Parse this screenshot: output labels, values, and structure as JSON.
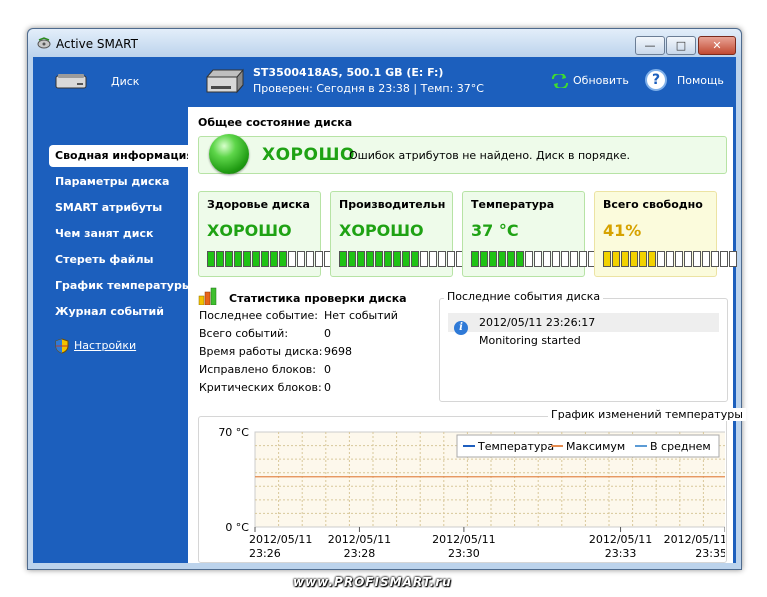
{
  "window": {
    "title": "Active SMART",
    "minimize_glyph": "—",
    "maximize_glyph": "□",
    "close_glyph": "✕"
  },
  "header": {
    "disk_label": "Диск",
    "model": "ST3500418AS, 500.1 GB (E: F:)",
    "status": "Проверен: Сегодня в 23:38 | Темп: 37°C",
    "refresh_label": "Обновить",
    "help_glyph": "?",
    "help_label": "Помощь"
  },
  "sidebar": {
    "items": [
      {
        "label": "Сводная информация",
        "active": true
      },
      {
        "label": "Параметры диска",
        "active": false
      },
      {
        "label": "SMART атрибуты",
        "active": false
      },
      {
        "label": "Чем занят диск",
        "active": false
      },
      {
        "label": "Стереть файлы",
        "active": false
      },
      {
        "label": "График температуры",
        "active": false
      },
      {
        "label": "Журнал событий",
        "active": false
      }
    ],
    "settings_label": "Настройки"
  },
  "overview": {
    "section_title": "Общее состояние диска",
    "status": "ХОРОШО",
    "message": "Ошибок атрибутов не найдено. Диск в порядке."
  },
  "cards": [
    {
      "title": "Здоровье диска",
      "value": "ХОРОШО",
      "level_fraction": 0.6,
      "color": "#1fc214"
    },
    {
      "title": "Производительн",
      "value": "ХОРОШО",
      "level_fraction": 0.6,
      "color": "#1fc214"
    },
    {
      "title": "Температура",
      "value": "37 °C",
      "level_fraction": 0.4,
      "color": "#1fc214"
    },
    {
      "title": "Всего свободно",
      "value": "41%",
      "level_fraction": 0.4,
      "color": "#f2d200"
    }
  ],
  "stats": {
    "title": "Статистика проверки диска",
    "rows": [
      {
        "label": "Последнее событие:",
        "value": "Нет событий"
      },
      {
        "label": "Всего событий:",
        "value": "0"
      },
      {
        "label": "Время работы диска:",
        "value": "9698"
      },
      {
        "label": "Исправлено блоков:",
        "value": "0"
      },
      {
        "label": "Критических блоков:",
        "value": "0"
      }
    ]
  },
  "events": {
    "title": "Последние события диска",
    "items": [
      {
        "time": "2012/05/11 23:26:17",
        "message": "Monitoring started"
      }
    ]
  },
  "chart_data": {
    "type": "line",
    "title": "График изменений температуры",
    "ylim": [
      0,
      70
    ],
    "ytick_labels": [
      "70 °C",
      "0 °C"
    ],
    "x_ticks": [
      {
        "date": "2012/05/11",
        "time": "23:26"
      },
      {
        "date": "2012/05/11",
        "time": "23:28"
      },
      {
        "date": "2012/05/11",
        "time": "23:30"
      },
      {
        "date": "2012/05/11",
        "time": "23:33"
      },
      {
        "date": "2012/05/11",
        "time": "23:35"
      }
    ],
    "legend": [
      "Температура",
      "Максимум",
      "В среднем"
    ],
    "legend_colors": [
      "#1f5fbf",
      "#e38a4e",
      "#5b9bd5"
    ],
    "legend_position": "top-right",
    "grid": true,
    "series": [
      {
        "name": "Максимум",
        "x": [
          "23:26",
          "23:35"
        ],
        "values": [
          37,
          37
        ]
      }
    ]
  },
  "footer": {
    "brand": "www.PROFISMART.ru"
  }
}
